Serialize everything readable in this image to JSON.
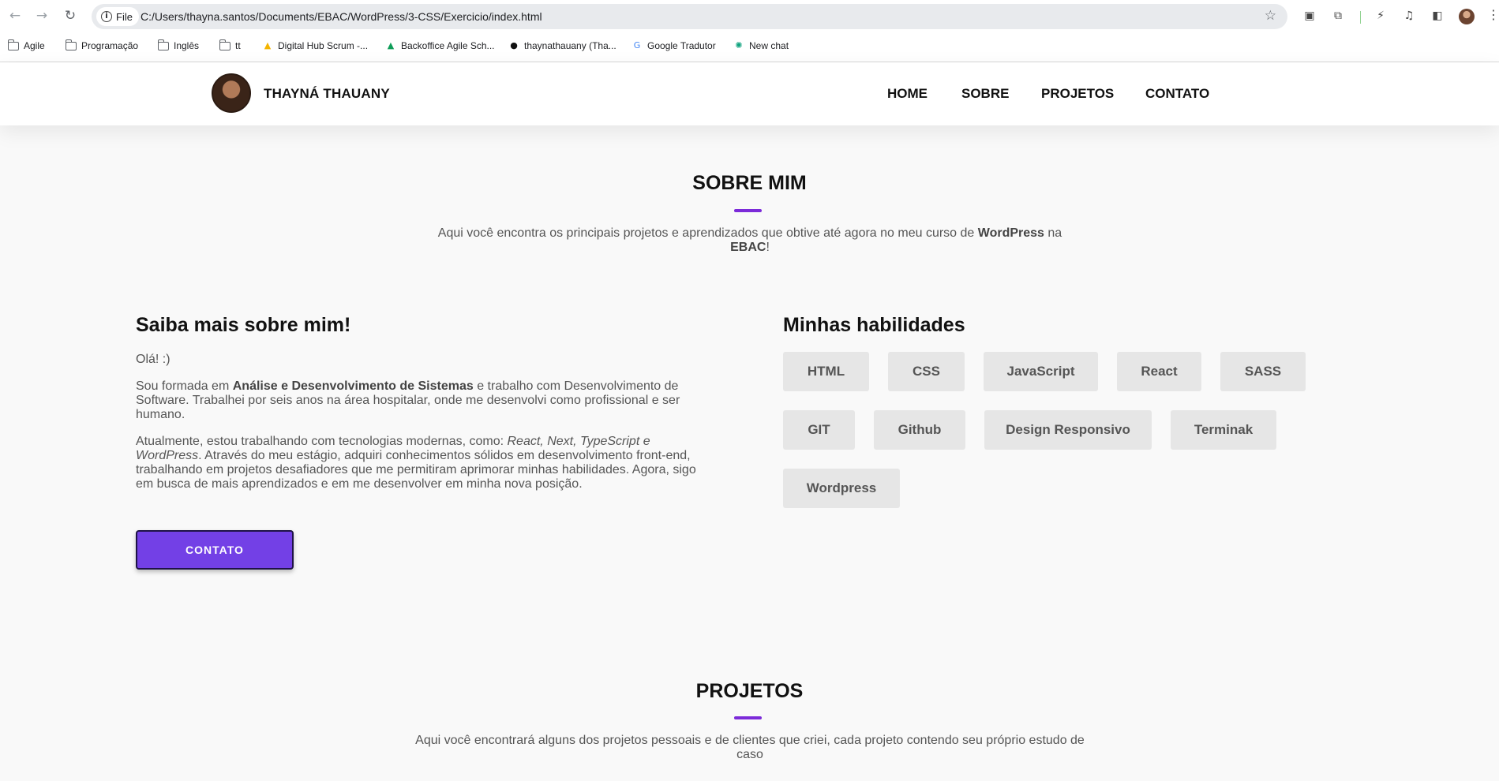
{
  "browser": {
    "chip_label": "File",
    "url": "C:/Users/thayna.santos/Documents/EBAC/WordPress/3-CSS/Exercicio/index.html",
    "bookmarks": [
      {
        "label": "Agile",
        "icon": "folder-icon"
      },
      {
        "label": "Programação",
        "icon": "folder-icon"
      },
      {
        "label": "Inglês",
        "icon": "folder-icon"
      },
      {
        "label": "tt",
        "icon": "folder-icon"
      },
      {
        "label": "Digital Hub Scrum -...",
        "icon": "drive-icon"
      },
      {
        "label": "Backoffice Agile Sch...",
        "icon": "drive-icon"
      },
      {
        "label": "thaynathauany (Tha...",
        "icon": "github-icon"
      },
      {
        "label": "Google Tradutor",
        "icon": "translate-icon"
      },
      {
        "label": "New chat",
        "icon": "chatgpt-icon"
      }
    ]
  },
  "site": {
    "brand": "THAYNÁ THAUANY",
    "nav": [
      "HOME",
      "SOBRE",
      "PROJETOS",
      "CONTATO"
    ],
    "accent_color": "#7c2bd9",
    "button_color": "#7340e6"
  },
  "about_section": {
    "title": "SOBRE MIM",
    "subtitle_pre": "Aqui você encontra os principais projetos e aprendizados que obtive até agora no meu curso de ",
    "subtitle_bold1": "WordPress",
    "subtitle_mid": " na ",
    "subtitle_bold2": "EBAC",
    "subtitle_end": "!",
    "heading": "Saiba mais sobre mim!",
    "greeting": "Olá! :)",
    "p1_pre": "Sou formada em ",
    "p1_bold": "Análise e Desenvolvimento de Sistemas",
    "p1_post": " e trabalho com Desenvolvimento de Software. Trabalhei por seis anos na área hospitalar, onde me desenvolvi como profissional e ser humano.",
    "p2_pre": "Atualmente, estou trabalhando com tecnologias modernas, como: ",
    "p2_italic": "React, Next, TypeScript e WordPress",
    "p2_post": ". Através do meu estágio, adquiri conhecimentos sólidos em desenvolvimento front-end, trabalhando em projetos desafiadores que me permitiram aprimorar minhas habilidades. Agora, sigo em busca de mais aprendizados e em me desenvolver em minha nova posição.",
    "button": "CONTATO"
  },
  "skills": {
    "title": "Minhas habilidades",
    "items": [
      "HTML",
      "CSS",
      "JavaScript",
      "React",
      "SASS",
      "GIT",
      "Github",
      "Design Responsivo",
      "Terminak",
      "Wordpress"
    ]
  },
  "projects_section": {
    "title": "PROJETOS",
    "subtitle": "Aqui você encontrará alguns dos projetos pessoais e de clientes que criei, cada projeto contendo seu próprio estudo de caso"
  }
}
